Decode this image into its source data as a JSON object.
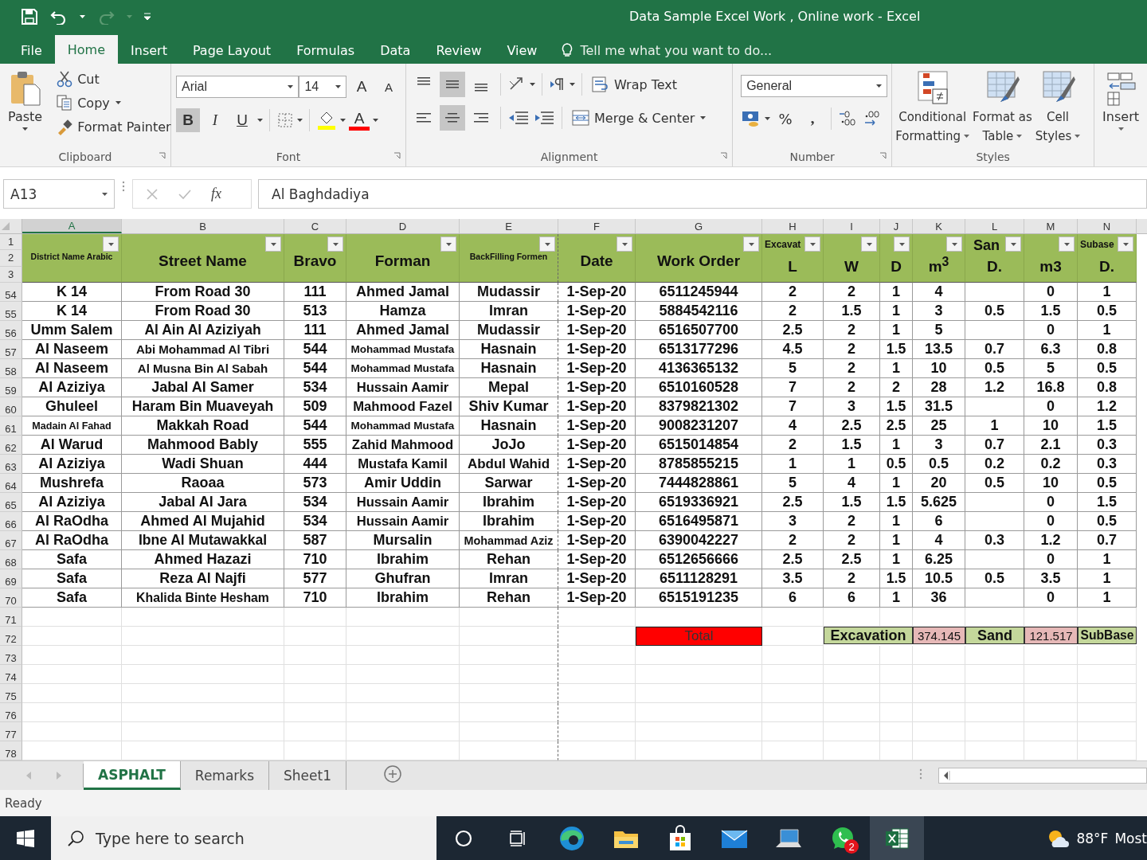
{
  "title_bar": {
    "title": "Data Sample Excel Work , Online work - Excel"
  },
  "menu_tabs": [
    {
      "label": "File",
      "selected": false
    },
    {
      "label": "Home",
      "selected": true
    },
    {
      "label": "Insert",
      "selected": false
    },
    {
      "label": "Page Layout",
      "selected": false
    },
    {
      "label": "Formulas",
      "selected": false
    },
    {
      "label": "Data",
      "selected": false
    },
    {
      "label": "Review",
      "selected": false
    },
    {
      "label": "View",
      "selected": false
    }
  ],
  "tell_me": "Tell me what you want to do...",
  "ribbon": {
    "clipboard": {
      "paste": "Paste",
      "cut": "Cut",
      "copy": "Copy",
      "format_painter": "Format Painter",
      "label": "Clipboard"
    },
    "font": {
      "name": "Arial",
      "size": "14",
      "grow": "A",
      "shrink": "A",
      "styles": [
        {
          "glyph": "B",
          "selected": true
        },
        {
          "glyph": "I",
          "selected": false
        },
        {
          "glyph": "U",
          "selected": false
        }
      ],
      "font_color": "A",
      "label": "Font"
    },
    "alignment": {
      "vertical": [
        {
          "selected": false
        },
        {
          "selected": true
        },
        {
          "selected": false
        }
      ],
      "horizontal": [
        {
          "selected": false
        },
        {
          "selected": true
        },
        {
          "selected": false
        }
      ],
      "wrap_text": "Wrap Text",
      "merge": "Merge & Center",
      "label": "Alignment"
    },
    "number": {
      "format": "General",
      "percent": "%",
      "comma": ",",
      "label": "Number"
    },
    "styles": {
      "buttons": [
        {
          "top": "Conditional",
          "bottom": "Formatting"
        },
        {
          "top": "Format as",
          "bottom": "Table"
        },
        {
          "top": "Cell",
          "bottom": "Styles"
        }
      ],
      "label": "Styles"
    },
    "cells": {
      "insert": "Insert"
    }
  },
  "formula_bar": {
    "name_box": "A13",
    "function_label": "fx",
    "formula": "Al Baghdadiya"
  },
  "columns": [
    {
      "letter": "A",
      "selected": true
    },
    {
      "letter": "B",
      "selected": false
    },
    {
      "letter": "C",
      "selected": false
    },
    {
      "letter": "D",
      "selected": false
    },
    {
      "letter": "E",
      "selected": false
    },
    {
      "letter": "F",
      "selected": false
    },
    {
      "letter": "G",
      "selected": false
    },
    {
      "letter": "H",
      "selected": false
    },
    {
      "letter": "I",
      "selected": false
    },
    {
      "letter": "J",
      "selected": false
    },
    {
      "letter": "K",
      "selected": false
    },
    {
      "letter": "L",
      "selected": false
    },
    {
      "letter": "M",
      "selected": false
    },
    {
      "letter": "N",
      "selected": false
    }
  ],
  "header_rows": [
    "1",
    "2",
    "3"
  ],
  "headers": [
    {
      "kind": "small",
      "label": "District Name Arabic"
    },
    {
      "kind": "main",
      "label": "Street Name"
    },
    {
      "kind": "main",
      "label": "Bravo"
    },
    {
      "kind": "main",
      "label": "Forman"
    },
    {
      "kind": "small",
      "label": "BackFilling Formen"
    },
    {
      "kind": "main",
      "label": "Date"
    },
    {
      "kind": "main",
      "label": "Work Order"
    },
    {
      "kind": "split_small_top",
      "top": "Excavat",
      "bottom": "L"
    },
    {
      "kind": "split",
      "bottom": "W"
    },
    {
      "kind": "split",
      "bottom": "D"
    },
    {
      "kind": "split",
      "bottom": "m$^{3}$"
    },
    {
      "kind": "split_large_top",
      "top": "San",
      "bottom": "D."
    },
    {
      "kind": "split",
      "bottom": "m3"
    },
    {
      "kind": "split_small_top",
      "top": "Subase",
      "bottom": "D."
    }
  ],
  "rows": [
    {
      "number": "54",
      "cells": [
        "K 14",
        "From Road 30",
        "111",
        "Ahmed Jamal",
        "Mudassir",
        "1-Sep-20",
        "6511245944",
        "2",
        "2",
        "1",
        "4",
        null,
        "0",
        "1"
      ]
    },
    {
      "number": "55",
      "cells": [
        "K 14",
        "From Road 30",
        "513",
        "Hamza",
        "Imran",
        "1-Sep-20",
        "5884542116",
        "2",
        "1.5",
        "1",
        "3",
        "0.5",
        "1.5",
        "0.5"
      ]
    },
    {
      "number": "56",
      "cells": [
        "Umm Salem",
        "Al Ain Al Aziziyah",
        "111",
        "Ahmed Jamal",
        "Mudassir",
        "1-Sep-20",
        "6516507700",
        "2.5",
        "2",
        "1",
        "5",
        null,
        "0",
        "1"
      ]
    },
    {
      "number": "57",
      "cells": [
        "Al Naseem",
        "Abi Mohammad Al Tibri",
        "544",
        "Mohammad Mustafa",
        "Hasnain",
        "1-Sep-20",
        "6513177296",
        "4.5",
        "2",
        "1.5",
        "13.5",
        "0.7",
        "6.3",
        "0.8"
      ]
    },
    {
      "number": "58",
      "cells": [
        "Al Naseem",
        "Al Musna Bin Al Sabah",
        "544",
        "Mohammad Mustafa",
        "Hasnain",
        "1-Sep-20",
        "4136365132",
        "5",
        "2",
        "1",
        "10",
        "0.5",
        "5",
        "0.5"
      ]
    },
    {
      "number": "59",
      "cells": [
        "Al Aziziya",
        "Jabal Al Samer",
        "534",
        "Hussain Aamir",
        "Mepal",
        "1-Sep-20",
        "6510160528",
        "7",
        "2",
        "2",
        "28",
        "1.2",
        "16.8",
        "0.8"
      ]
    },
    {
      "number": "60",
      "cells": [
        "Ghuleel",
        "Haram Bin Muaveyah",
        "509",
        "Mahmood Fazel",
        "Shiv Kumar",
        "1-Sep-20",
        "8379821302",
        "7",
        "3",
        "1.5",
        "31.5",
        null,
        "0",
        "1.2"
      ]
    },
    {
      "number": "61",
      "cells": [
        "Madain Al Fahad",
        "Makkah Road",
        "544",
        "Mohammad Mustafa",
        "Hasnain",
        "1-Sep-20",
        "9008231207",
        "4",
        "2.5",
        "2.5",
        "25",
        "1",
        "10",
        "1.5"
      ]
    },
    {
      "number": "62",
      "cells": [
        "Al Warud",
        "Mahmood Bably",
        "555",
        "Zahid Mahmood",
        "JoJo",
        "1-Sep-20",
        "6515014854",
        "2",
        "1.5",
        "1",
        "3",
        "0.7",
        "2.1",
        "0.3"
      ]
    },
    {
      "number": "63",
      "cells": [
        "Al Aziziya",
        "Wadi Shuan",
        "444",
        "Mustafa Kamil",
        "Abdul Wahid",
        "1-Sep-20",
        "8785855215",
        "1",
        "1",
        "0.5",
        "0.5",
        "0.2",
        "0.2",
        "0.3"
      ]
    },
    {
      "number": "64",
      "cells": [
        "Mushrefa",
        "Raoaa",
        "573",
        "Amir Uddin",
        "Sarwar",
        "1-Sep-20",
        "7444828861",
        "5",
        "4",
        "1",
        "20",
        "0.5",
        "10",
        "0.5"
      ]
    },
    {
      "number": "65",
      "cells": [
        "Al Aziziya",
        "Jabal Al Jara",
        "534",
        "Hussain Aamir",
        "Ibrahim",
        "1-Sep-20",
        "6519336921",
        "2.5",
        "1.5",
        "1.5",
        "5.625",
        null,
        "0",
        "1.5"
      ]
    },
    {
      "number": "66",
      "cells": [
        "Al RaOdha",
        "Ahmed Al Mujahid",
        "534",
        "Hussain Aamir",
        "Ibrahim",
        "1-Sep-20",
        "6516495871",
        "3",
        "2",
        "1",
        "6",
        null,
        "0",
        "0.5"
      ]
    },
    {
      "number": "67",
      "cells": [
        "Al RaOdha",
        "Ibne Al Mutawakkal",
        "587",
        "Mursalin",
        "Mohammad Aziz",
        "1-Sep-20",
        "6390042227",
        "2",
        "2",
        "1",
        "4",
        "0.3",
        "1.2",
        "0.7"
      ]
    },
    {
      "number": "68",
      "cells": [
        "Safa",
        "Ahmed Hazazi",
        "710",
        "Ibrahim",
        "Rehan",
        "1-Sep-20",
        "6512656666",
        "2.5",
        "2.5",
        "1",
        "6.25",
        null,
        "0",
        "1"
      ]
    },
    {
      "number": "69",
      "cells": [
        "Safa",
        "Reza Al Najfi",
        "577",
        "Ghufran",
        "Imran",
        "1-Sep-20",
        "6511128291",
        "3.5",
        "2",
        "1.5",
        "10.5",
        "0.5",
        "3.5",
        "1"
      ]
    },
    {
      "number": "70",
      "cells": [
        "Safa",
        "Khalida Binte Hesham",
        "710",
        "Ibrahim",
        "Rehan",
        "1-Sep-20",
        "6515191235",
        "6",
        "6",
        "1",
        "36",
        null,
        "0",
        "1"
      ]
    },
    {
      "number": "71"
    },
    {
      "number": "72",
      "summary": [
        {
          "kind": "blank"
        },
        {
          "kind": "blank"
        },
        {
          "kind": "blank"
        },
        {
          "kind": "blank"
        },
        {
          "kind": "blank"
        },
        {
          "kind": "blank"
        },
        {
          "kind": "total",
          "text": "Total"
        },
        {
          "kind": "blank"
        },
        {
          "kind": "wide_label",
          "text": "Excavation"
        },
        {
          "kind": "value",
          "text": "374.145"
        },
        {
          "kind": "label",
          "text": "Sand"
        },
        {
          "kind": "value",
          "text": "121.517"
        },
        {
          "kind": "label",
          "text": "SubBase"
        }
      ]
    },
    {
      "number": "73"
    },
    {
      "number": "74"
    },
    {
      "number": "75"
    },
    {
      "number": "76"
    },
    {
      "number": "77"
    },
    {
      "number": "78"
    }
  ],
  "sheet_tabs": [
    {
      "label": "ASPHALT",
      "selected": true
    },
    {
      "label": "Remarks",
      "selected": false
    },
    {
      "label": "Sheet1",
      "selected": false
    }
  ],
  "status_bar": {
    "text": "Ready"
  },
  "taskbar": {
    "search_placeholder": "Type here to search",
    "whatsapp_badge": "2",
    "temperature": "88°F",
    "weather_text": "Most"
  }
}
